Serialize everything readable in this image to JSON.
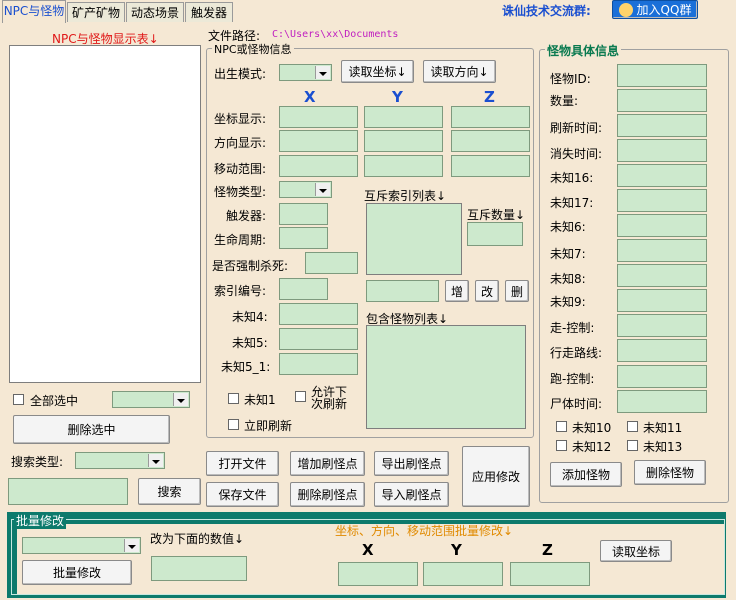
{
  "tabs": [
    "NPC与怪物",
    "矿产矿物",
    "动态场景",
    "触发器"
  ],
  "header": {
    "community_label": "诛仙技术交流群:",
    "qq_button": "加入QQ群",
    "file_path_label": "文件路径:",
    "file_path_value": "C:\\Users\\xx\\Documents"
  },
  "left_panel": {
    "title": "NPC与怪物显示表↓",
    "select_all": "全部选中",
    "delete_selected": "删除选中",
    "search_type_label": "搜索类型:",
    "search_button": "搜索"
  },
  "npc_info": {
    "title": "NPC或怪物信息",
    "birth_mode": "出生模式:",
    "read_coords": "读取坐标↓",
    "read_direction": "读取方向↓",
    "axes": [
      "X",
      "Y",
      "Z"
    ],
    "rows": [
      "坐标显示:",
      "方向显示:",
      "移动范围:"
    ],
    "monster_type": "怪物类型:",
    "trigger": "触发器:",
    "life_cycle": "生命周期:",
    "force_kill": "是否强制杀死:",
    "index_no": "索引编号:",
    "unknown4": "未知4:",
    "unknown5": "未知5:",
    "unknown5_1": "未知5_1:",
    "mutex_list": "互斥索引列表↓",
    "mutex_count": "互斥数量↓",
    "add": "增",
    "edit": "改",
    "del": "删",
    "contains_list": "包含怪物列表↓",
    "unknown1": "未知1",
    "allow_refresh": "允许下次刷新",
    "refresh_now": "立即刷新"
  },
  "buttons": {
    "open_file": "打开文件",
    "save_file": "保存文件",
    "add_point": "增加刷怪点",
    "delete_point": "删除刷怪点",
    "export_point": "导出刷怪点",
    "import_point": "导入刷怪点",
    "apply": "应用修改"
  },
  "monster_detail": {
    "title": "怪物具体信息",
    "fields": [
      "怪物ID:",
      "数量:",
      "刷新时间:",
      "消失时间:",
      "未知16:",
      "未知17:",
      "未知6:",
      "未知7:",
      "未知8:",
      "未知9:",
      "走-控制:",
      "行走路线:",
      "跑-控制:",
      "尸体时间:"
    ],
    "checks": [
      "未知10",
      "未知11",
      "未知12",
      "未知13"
    ],
    "add_monster": "添加怪物",
    "delete_monster": "删除怪物"
  },
  "batch": {
    "title": "批量修改",
    "change_to": "改为下面的数值↓",
    "batch_button": "批量修改",
    "range_title": "坐标、方向、移动范围批量修改↓",
    "axes": [
      "X",
      "Y",
      "Z"
    ],
    "read_coords": "读取坐标"
  },
  "colors": {
    "accent_blue": "#1a4fd0",
    "red": "#e01818",
    "field_green": "#cde9cd",
    "batch_bg": "#0d7a6c"
  }
}
